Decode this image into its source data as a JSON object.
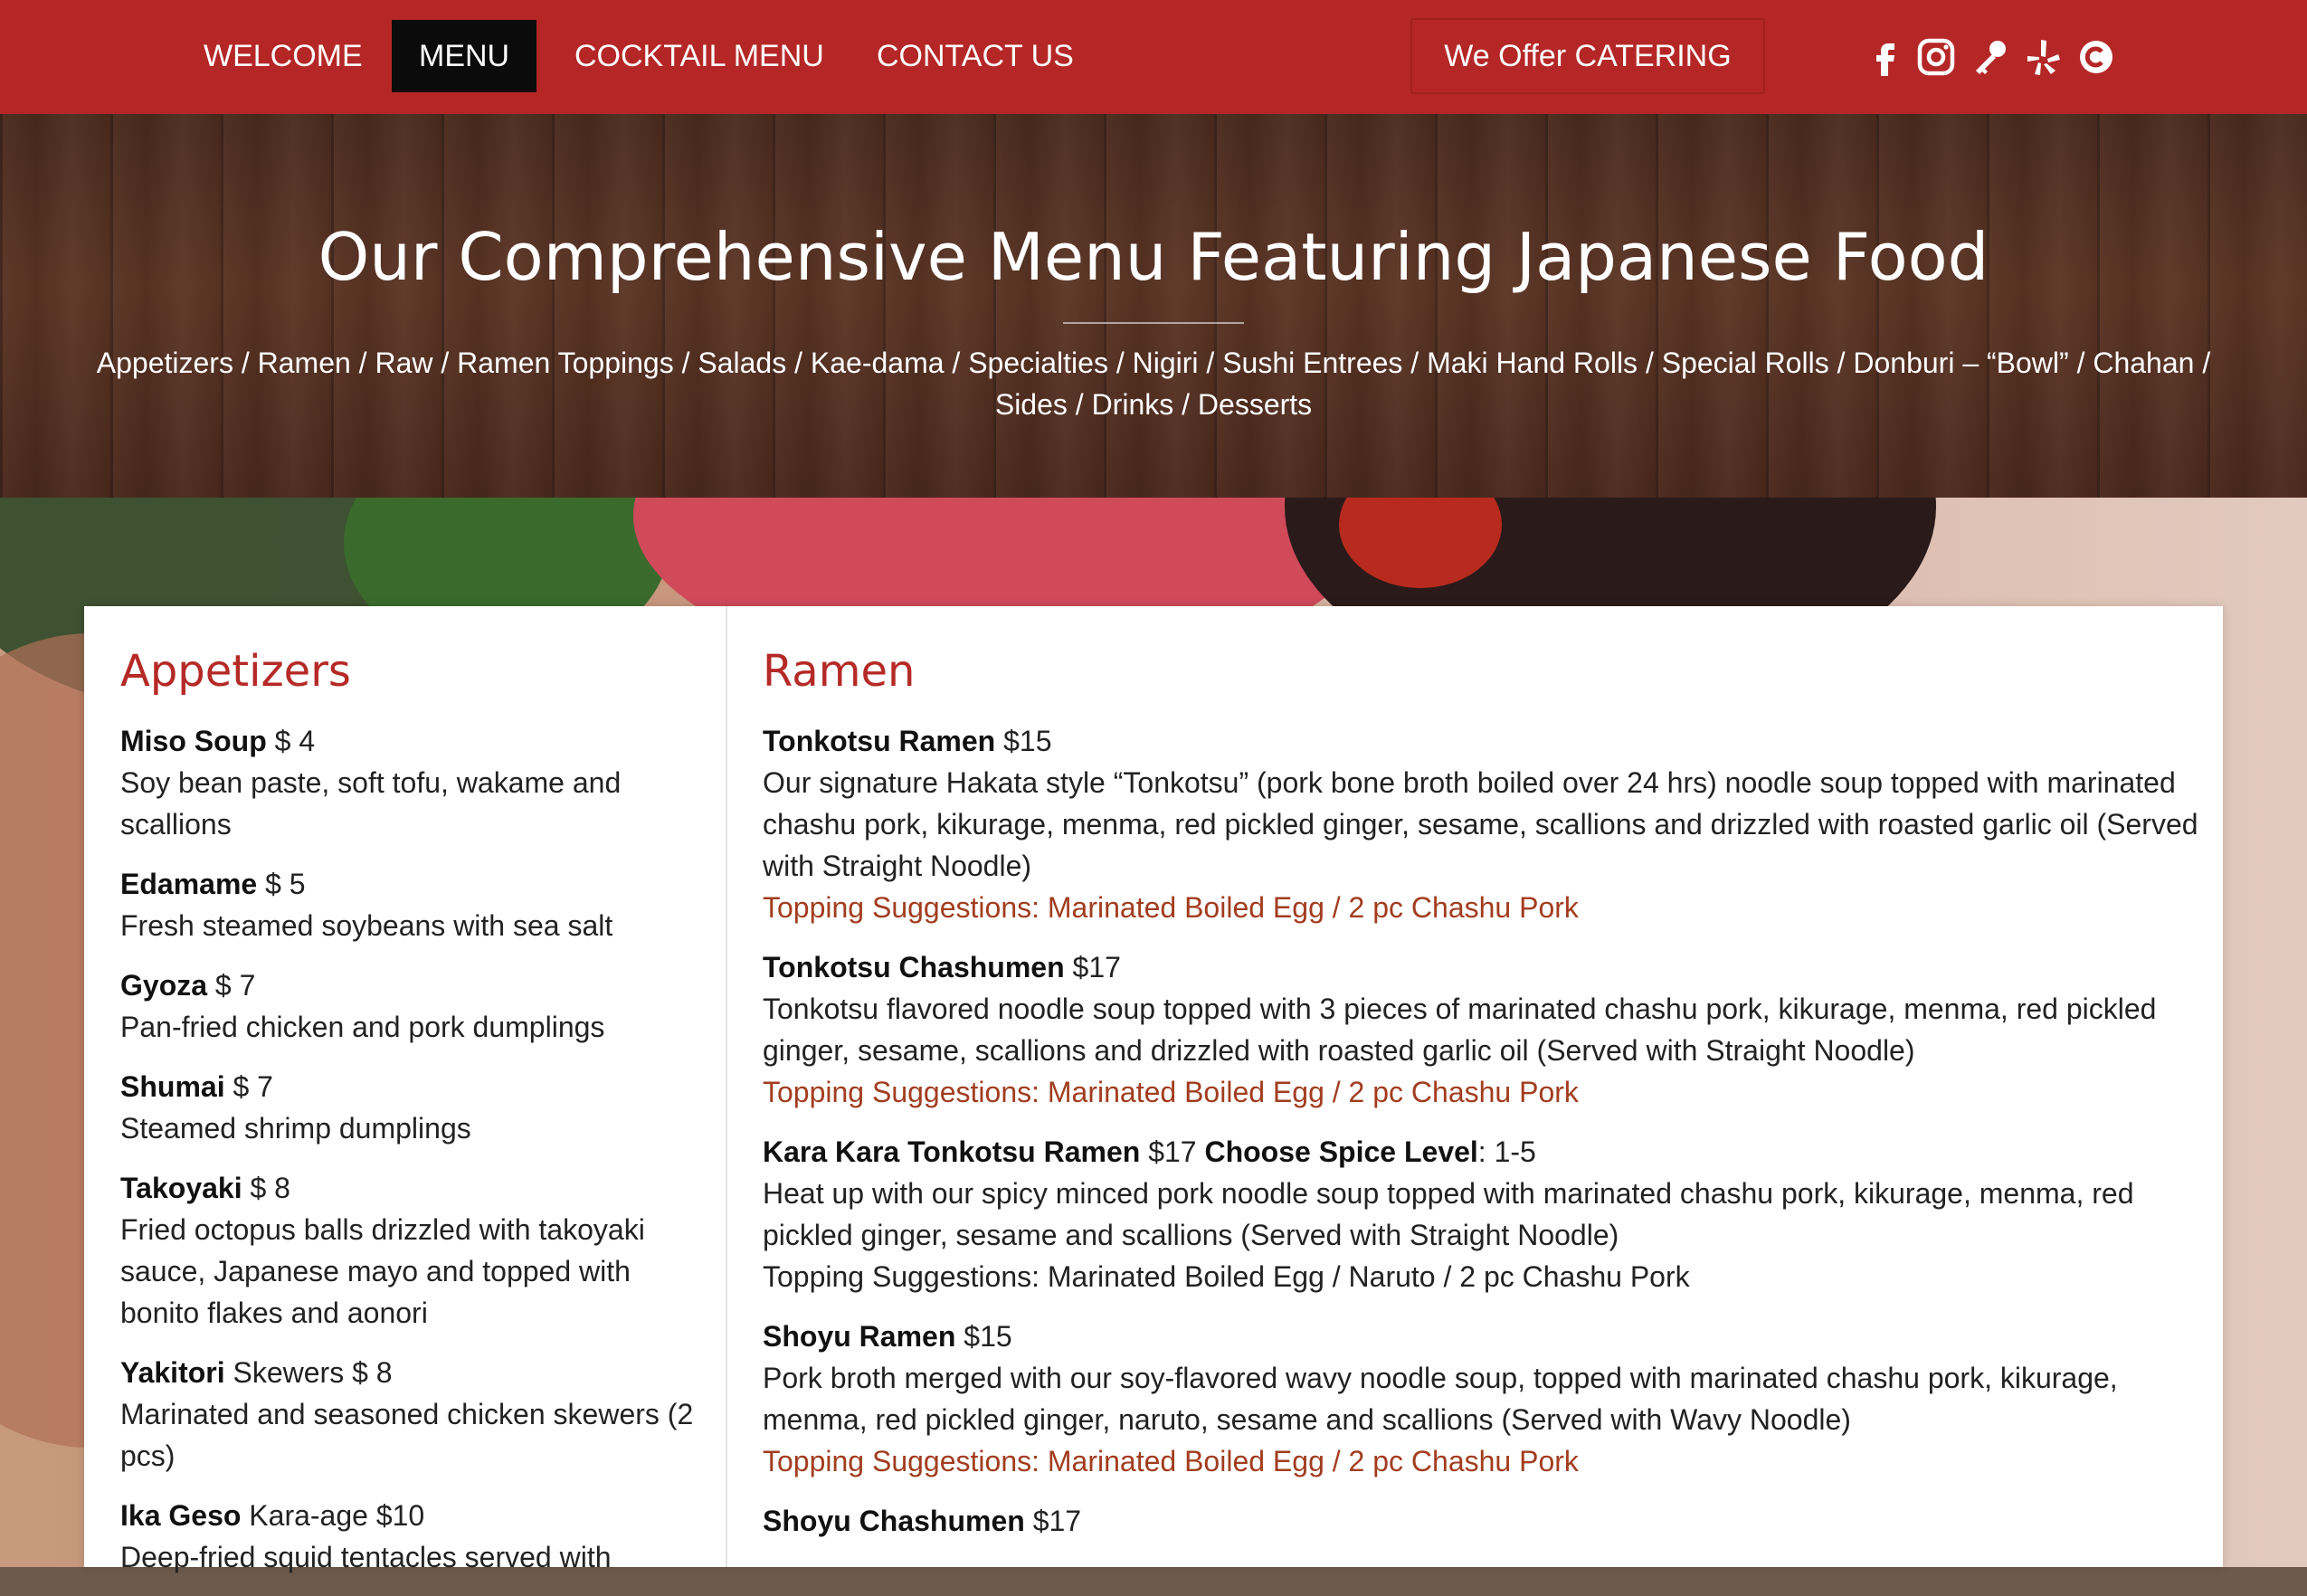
{
  "nav": {
    "links": [
      "WELCOME",
      "MENU",
      "COCKTAIL MENU",
      "CONTACT US"
    ],
    "active": "MENU",
    "catering_label": "We Offer CATERING",
    "social_icons": [
      "facebook-icon",
      "instagram-icon",
      "key-icon",
      "yelp-icon",
      "copyright-icon"
    ]
  },
  "hero": {
    "title": "Our Comprehensive Menu Featuring Japanese Food",
    "category_links": [
      "Appetizers",
      "Ramen",
      "Raw",
      "Ramen Toppings",
      "Salads",
      "Kae-dama",
      "Specialties",
      "Nigiri",
      "Sushi Entrees",
      "Maki Hand Rolls",
      "Special Rolls",
      "Donburi – “Bowl”",
      "Chahan",
      "Sides",
      "Drinks",
      "Desserts"
    ],
    "separator": " / "
  },
  "appetizers": {
    "title": "Appetizers",
    "items": [
      {
        "name": "Miso Soup",
        "price": " $ 4",
        "desc": "Soy bean paste, soft tofu, wakame and scallions"
      },
      {
        "name": "Edamame",
        "price": " $ 5",
        "desc": "Fresh steamed soybeans with sea salt"
      },
      {
        "name": "Gyoza",
        "price": " $ 7",
        "desc": "Pan-fried chicken and pork dumplings"
      },
      {
        "name": "Shumai",
        "price": " $ 7",
        "desc": "Steamed shrimp dumplings"
      },
      {
        "name": "Takoyaki",
        "price": " $ 8",
        "desc": "Fried octopus balls drizzled with takoyaki sauce, Japanese mayo and topped with bonito flakes and aonori"
      },
      {
        "name": "Yakitori",
        "price": " Skewers $ 8",
        "desc": "Marinated and seasoned chicken skewers (2 pcs)"
      },
      {
        "name": "Ika Geso",
        "price": " Kara-age $10",
        "desc": "Deep-fried squid tentacles served with"
      }
    ]
  },
  "ramen": {
    "title": "Ramen",
    "items": [
      {
        "name": "Tonkotsu Ramen",
        "price": " $15",
        "extra_bold": "",
        "extra": "",
        "desc": "Our signature Hakata style “Tonkotsu” (pork bone broth boiled over 24 hrs) noodle soup topped with marinated chashu pork, kikurage, menma, red pickled ginger, sesame, scallions and drizzled with roasted garlic oil (Served with Straight Noodle)",
        "toppings": "Topping Suggestions: Marinated Boiled Egg / 2 pc Chashu Pork"
      },
      {
        "name": "Tonkotsu Chashumen",
        "price": " $17",
        "extra_bold": "",
        "extra": "",
        "desc": "Tonkotsu flavored noodle soup topped with 3 pieces of marinated chashu pork, kikurage, menma, red pickled ginger, sesame, scallions and drizzled with roasted garlic oil (Served with Straight Noodle)",
        "toppings": "Topping Suggestions: Marinated Boiled Egg / 2 pc Chashu Pork"
      },
      {
        "name": "Kara Kara Tonkotsu Ramen",
        "price": " $17 ",
        "extra_bold": "Choose Spice Level",
        "extra": ": 1-5",
        "desc": "Heat up with our spicy minced pork noodle soup topped with marinated chashu pork, kikurage, menma, red pickled ginger, sesame and scallions (Served with Straight Noodle)",
        "toppings": "Topping Suggestions: Marinated Boiled Egg / Naruto / 2 pc Chashu Pork"
      },
      {
        "name": "Shoyu Ramen",
        "price": " $15",
        "extra_bold": "",
        "extra": "",
        "desc": "Pork broth merged with our soy-flavored wavy noodle soup, topped with marinated chashu pork, kikurage, menma, red pickled ginger, naruto, sesame and scallions (Served with Wavy Noodle)",
        "toppings": "Topping Suggestions: Marinated Boiled Egg / 2 pc Chashu Pork"
      },
      {
        "name": "Shoyu Chashumen",
        "price": " $17",
        "extra_bold": "",
        "extra": "",
        "desc": "",
        "toppings": ""
      }
    ]
  },
  "colors": {
    "brand_red": "#b52727",
    "heading_red": "#b52a26",
    "topping_brown": "#a23d1f"
  }
}
